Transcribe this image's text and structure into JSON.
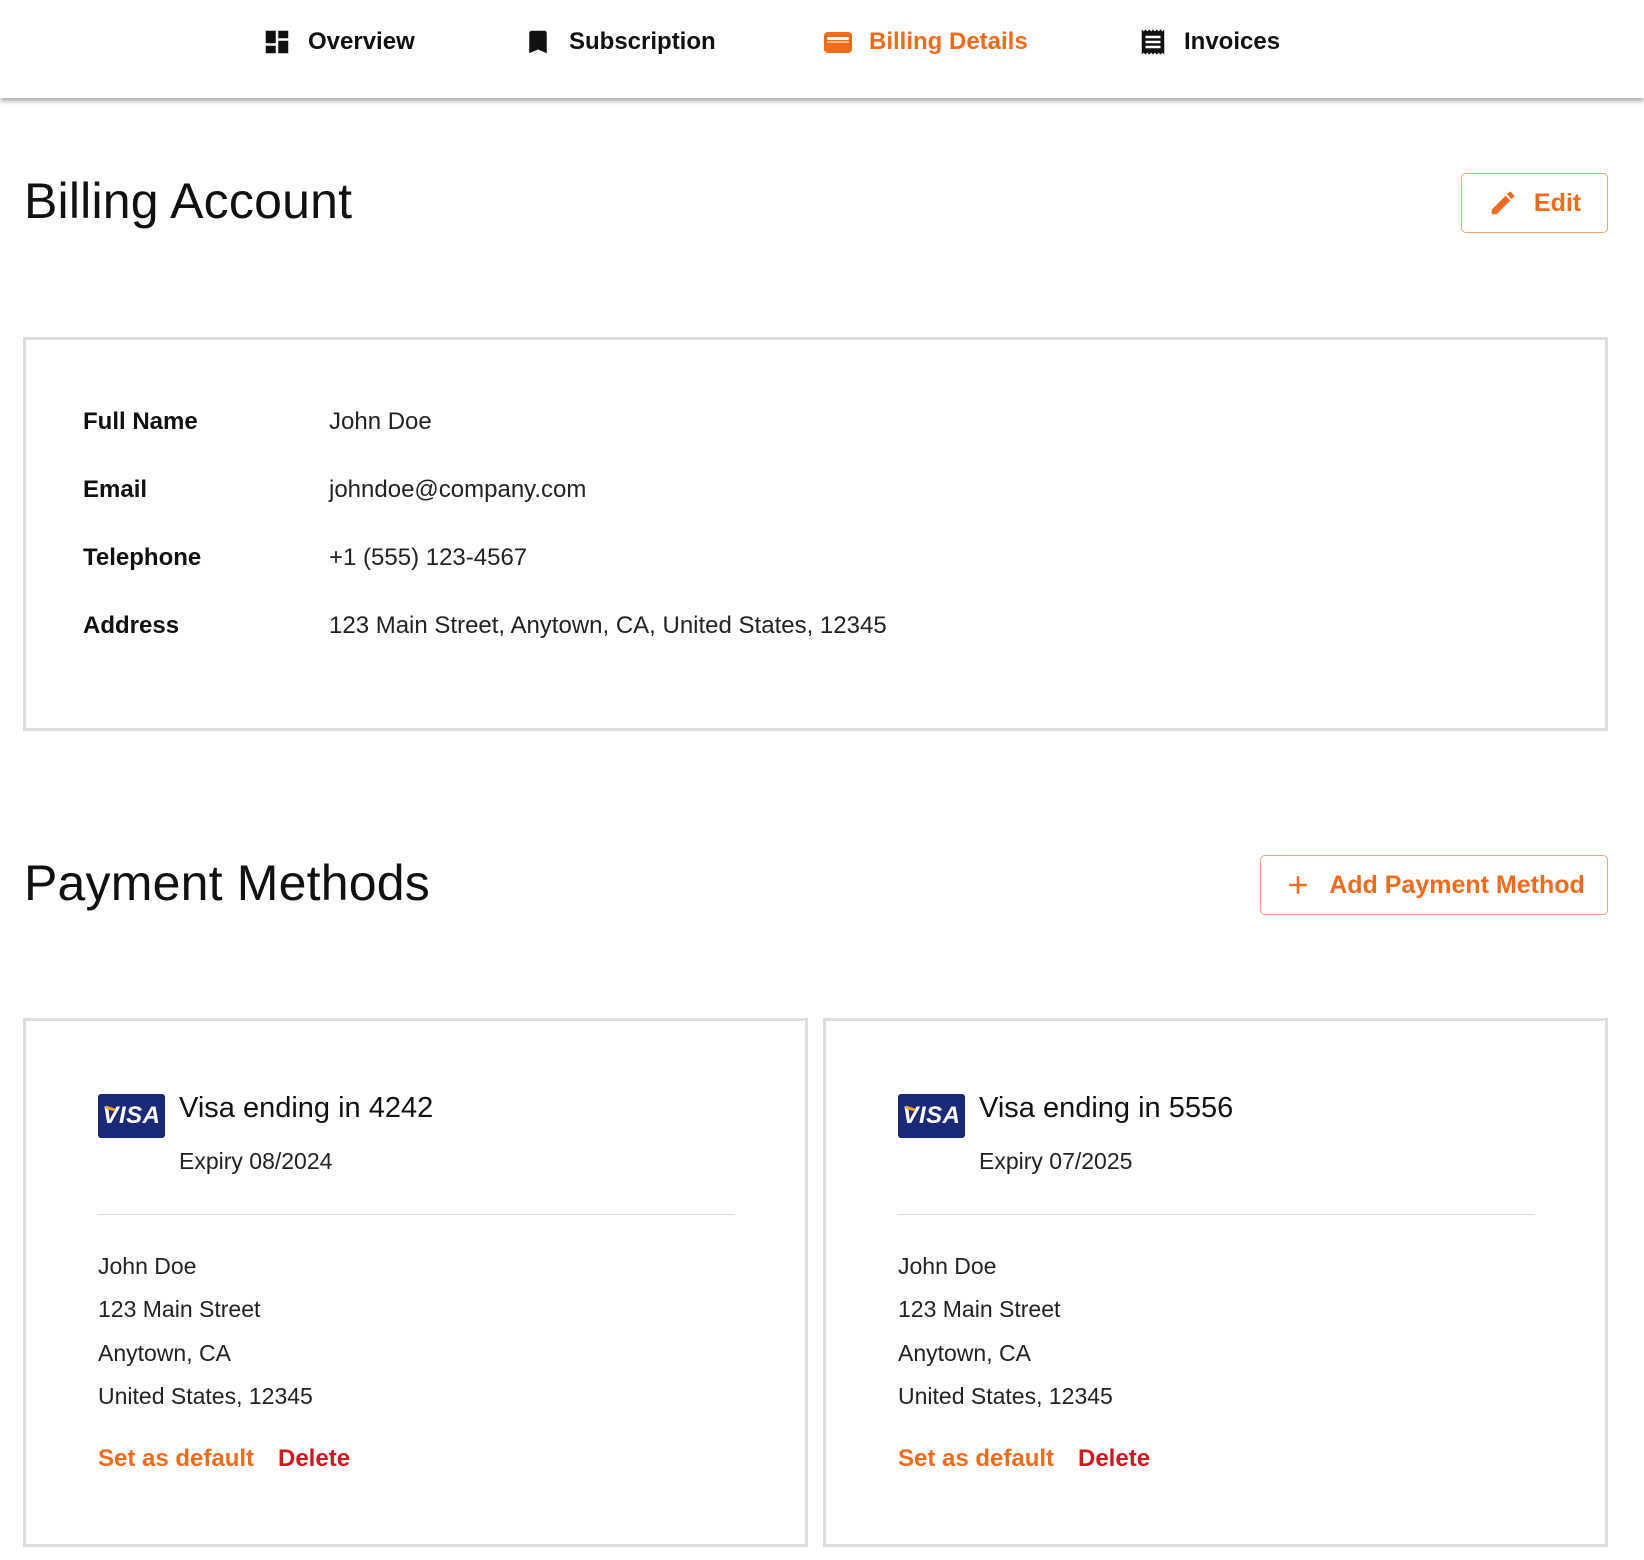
{
  "nav": {
    "tabs": [
      {
        "label": "Overview",
        "icon": "dashboard-icon",
        "active": false
      },
      {
        "label": "Subscription",
        "icon": "bookmark-icon",
        "active": false
      },
      {
        "label": "Billing Details",
        "icon": "wallet-icon",
        "active": true
      },
      {
        "label": "Invoices",
        "icon": "receipt-icon",
        "active": false
      }
    ]
  },
  "colors": {
    "accent": "#f26b1d",
    "danger": "#d2171f",
    "visa_blue": "#1a2a78"
  },
  "billing": {
    "title": "Billing Account",
    "edit_label": "Edit",
    "fields": [
      {
        "label": "Full Name",
        "value": "John Doe"
      },
      {
        "label": "Email",
        "value": "johndoe@company.com"
      },
      {
        "label": "Telephone",
        "value": "+1 (555) 123-4567"
      },
      {
        "label": "Address",
        "value": "123 Main Street, Anytown, CA, United States, 12345"
      }
    ]
  },
  "payment": {
    "title": "Payment Methods",
    "add_label": "Add Payment Method",
    "cards": [
      {
        "brand": "VISA",
        "title": "Visa ending in 4242",
        "expiry": "Expiry 08/2024",
        "address": [
          "John Doe",
          "123 Main Street",
          "Anytown, CA",
          "United States, 12345"
        ],
        "set_default_label": "Set as default",
        "delete_label": "Delete"
      },
      {
        "brand": "VISA",
        "title": "Visa ending in 5556",
        "expiry": "Expiry 07/2025",
        "address": [
          "John Doe",
          "123 Main Street",
          "Anytown, CA",
          "United States, 12345"
        ],
        "set_default_label": "Set as default",
        "delete_label": "Delete"
      }
    ]
  }
}
